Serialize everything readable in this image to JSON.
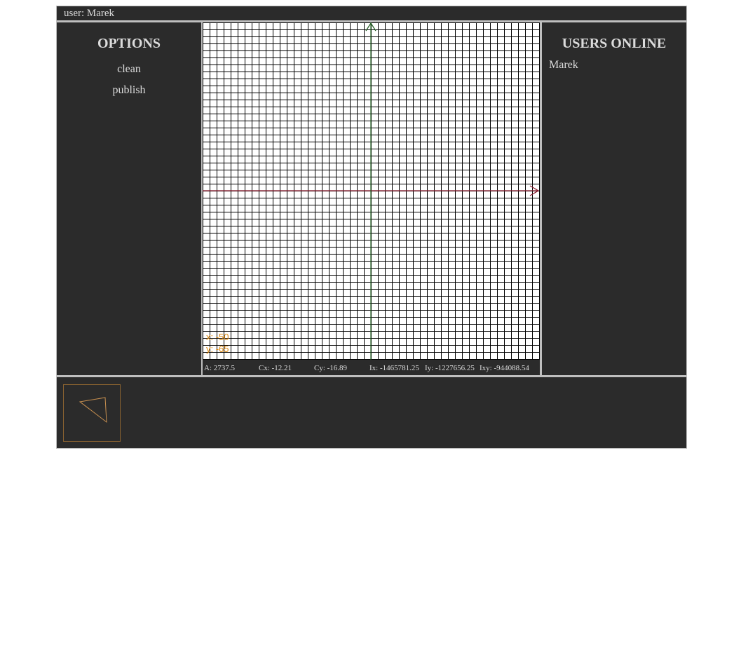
{
  "topbar": {
    "user_label": "user: Marek"
  },
  "options": {
    "title": "OPTIONS",
    "items": [
      {
        "label": "clean"
      },
      {
        "label": "publish"
      }
    ]
  },
  "canvas": {
    "background": "#ffffff",
    "grid_color": "#000000",
    "x_axis_color": "#8b1a2e",
    "y_axis_color": "#1f5a1f",
    "cursor_color": "#e08a10",
    "cursor": {
      "x_label": "x: -50",
      "y_label": "y: -65"
    },
    "stats": {
      "area": "A:  2737.5",
      "cx": "Cx:  -12.21",
      "cy": "Cy:  -16.89",
      "ix": "Ix:  -1465781.25",
      "iy": "Iy:  -1227656.25",
      "ixy": "Ixy:  -944088.54"
    }
  },
  "users": {
    "title": "USERS ONLINE",
    "list": [
      "Marek"
    ]
  },
  "shapes": {
    "thumb_border_color": "#8a6230",
    "thumb_stroke_color": "#c89050",
    "items": [
      {
        "icon": "triangle-shape-icon"
      }
    ]
  }
}
